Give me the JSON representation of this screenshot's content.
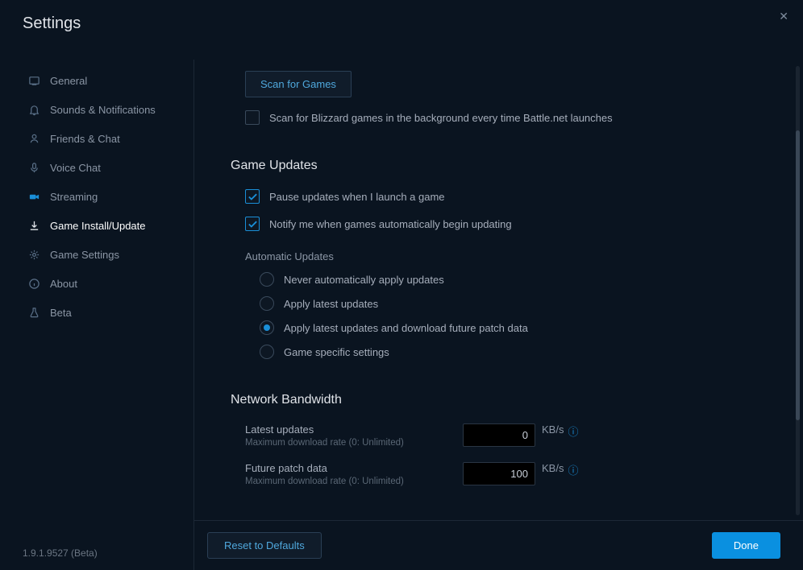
{
  "title": "Settings",
  "version": "1.9.1.9527 (Beta)",
  "sidebar": {
    "items": [
      {
        "label": "General"
      },
      {
        "label": "Sounds & Notifications"
      },
      {
        "label": "Friends & Chat"
      },
      {
        "label": "Voice Chat"
      },
      {
        "label": "Streaming"
      },
      {
        "label": "Game Install/Update"
      },
      {
        "label": "Game Settings"
      },
      {
        "label": "About"
      },
      {
        "label": "Beta"
      }
    ]
  },
  "main": {
    "scan_button": "Scan for Games",
    "scan_background_label": "Scan for Blizzard games in the background every time Battle.net launches",
    "updates_heading": "Game Updates",
    "pause_label": "Pause updates when I launch a game",
    "notify_label": "Notify me when games automatically begin updating",
    "auto_updates_label": "Automatic Updates",
    "radio_never": "Never automatically apply updates",
    "radio_latest": "Apply latest updates",
    "radio_future": "Apply latest updates and download future patch data",
    "radio_specific": "Game specific settings",
    "bandwidth_heading": "Network Bandwidth",
    "latest_label": "Latest updates",
    "latest_sub": "Maximum download rate (0: Unlimited)",
    "latest_value": "0",
    "future_label": "Future patch data",
    "future_sub": "Maximum download rate (0: Unlimited)",
    "future_value": "100",
    "unit": "KB/s"
  },
  "footer": {
    "reset": "Reset to Defaults",
    "done": "Done"
  }
}
